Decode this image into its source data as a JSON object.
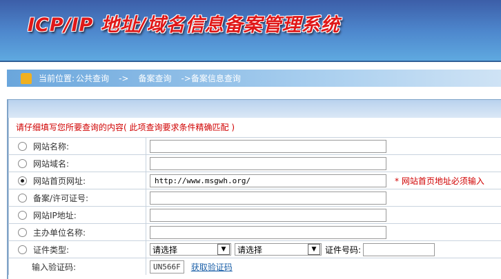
{
  "header": {
    "title": "ICP/IP 地址/域名信息备案管理系统"
  },
  "breadcrumb": {
    "prefix": "当前位置:",
    "items": [
      "公共查询",
      "->",
      "备案查询",
      "->备案信息查询"
    ]
  },
  "form": {
    "note": "请仔细填写您所要查询的内容( 此项查询要求条件精确匹配 )",
    "rows": [
      {
        "label": "网站名称:",
        "value": "",
        "checked": false
      },
      {
        "label": "网站域名:",
        "value": "",
        "checked": false
      },
      {
        "label": "网站首页网址:",
        "value": "http://www.msgwh.org/",
        "checked": true,
        "hint": "* 网站首页地址必须输入"
      },
      {
        "label": "备案/许可证号:",
        "value": "",
        "checked": false
      },
      {
        "label": "网站IP地址:",
        "value": "",
        "checked": false
      },
      {
        "label": "主办单位名称:",
        "value": "",
        "checked": false
      }
    ],
    "cert": {
      "label": "证件类型:",
      "select1": "请选择",
      "select2": "请选择",
      "number_label": "证件号码:",
      "number_value": ""
    },
    "captcha": {
      "label": "输入验证码:",
      "code": "UN566F",
      "refresh": "获取验证码"
    }
  }
}
